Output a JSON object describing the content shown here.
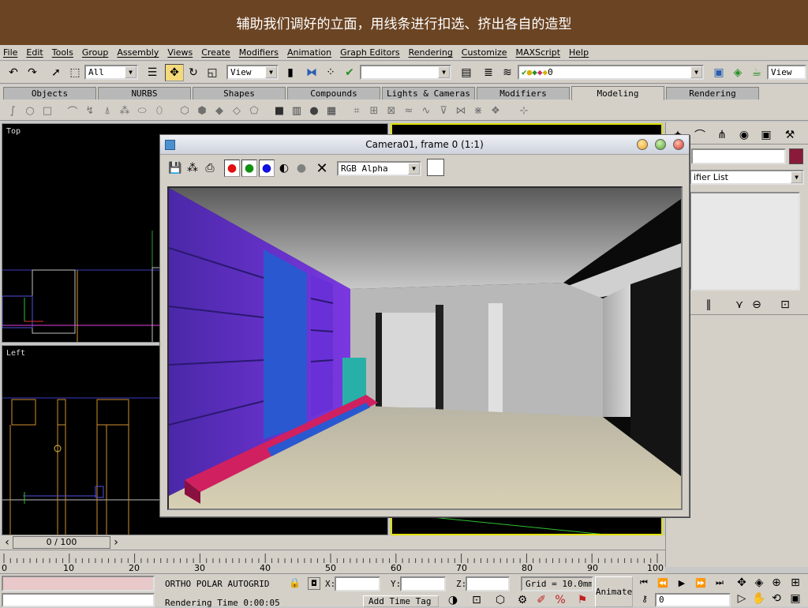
{
  "banner": {
    "text": "辅助我们调好的立面，用线条进行扣选、挤出各自的造型"
  },
  "menu": {
    "items": [
      "File",
      "Edit",
      "Tools",
      "Group",
      "Assembly",
      "Views",
      "Create",
      "Modifiers",
      "Animation",
      "Graph Editors",
      "Rendering",
      "Customize",
      "MAXScript",
      "Help"
    ]
  },
  "toolbar": {
    "selection_filter": "All",
    "ref_coord": "View",
    "named_selection": "",
    "layer": "0",
    "view_right": "View"
  },
  "tabs": {
    "items": [
      "Objects",
      "NURBS",
      "Shapes",
      "Compounds",
      "Lights & Cameras",
      "Modifiers",
      "Modeling",
      "Rendering"
    ],
    "active": "Modeling"
  },
  "viewports": {
    "top_label": "Top",
    "left_label": "Left"
  },
  "render_window": {
    "title": "Camera01, frame 0 (1:1)",
    "channel": "RGB Alpha"
  },
  "command_panel": {
    "modifier_list": "ifier List"
  },
  "timeline": {
    "frame": "0 / 100",
    "ticks": [
      "0",
      "10",
      "20",
      "30",
      "40",
      "50",
      "60",
      "70",
      "80",
      "90",
      "100"
    ]
  },
  "status": {
    "snap_modes": "ORTHO  POLAR  AUTOGRID",
    "x_label": "X:",
    "y_label": "Y:",
    "z_label": "Z:",
    "grid": "Grid = 10.0mm",
    "animate": "Animate",
    "render_time": "Rendering Time  0:00:05",
    "add_time_tag": "Add Time Tag",
    "frame_field": "0"
  }
}
